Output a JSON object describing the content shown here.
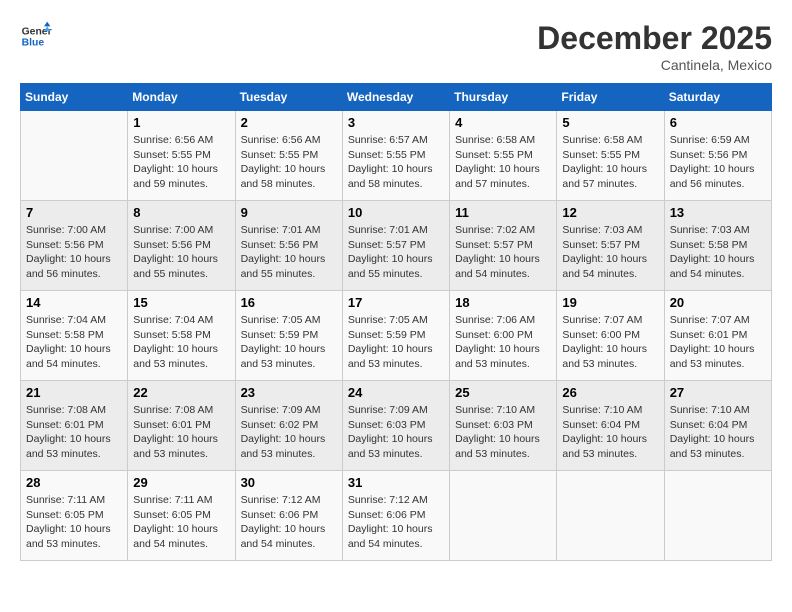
{
  "logo": {
    "text_general": "General",
    "text_blue": "Blue"
  },
  "title": "December 2025",
  "subtitle": "Cantinela, Mexico",
  "header_days": [
    "Sunday",
    "Monday",
    "Tuesday",
    "Wednesday",
    "Thursday",
    "Friday",
    "Saturday"
  ],
  "weeks": [
    [
      {
        "day": "",
        "info": ""
      },
      {
        "day": "1",
        "info": "Sunrise: 6:56 AM\nSunset: 5:55 PM\nDaylight: 10 hours\nand 59 minutes."
      },
      {
        "day": "2",
        "info": "Sunrise: 6:56 AM\nSunset: 5:55 PM\nDaylight: 10 hours\nand 58 minutes."
      },
      {
        "day": "3",
        "info": "Sunrise: 6:57 AM\nSunset: 5:55 PM\nDaylight: 10 hours\nand 58 minutes."
      },
      {
        "day": "4",
        "info": "Sunrise: 6:58 AM\nSunset: 5:55 PM\nDaylight: 10 hours\nand 57 minutes."
      },
      {
        "day": "5",
        "info": "Sunrise: 6:58 AM\nSunset: 5:55 PM\nDaylight: 10 hours\nand 57 minutes."
      },
      {
        "day": "6",
        "info": "Sunrise: 6:59 AM\nSunset: 5:56 PM\nDaylight: 10 hours\nand 56 minutes."
      }
    ],
    [
      {
        "day": "7",
        "info": "Sunrise: 7:00 AM\nSunset: 5:56 PM\nDaylight: 10 hours\nand 56 minutes."
      },
      {
        "day": "8",
        "info": "Sunrise: 7:00 AM\nSunset: 5:56 PM\nDaylight: 10 hours\nand 55 minutes."
      },
      {
        "day": "9",
        "info": "Sunrise: 7:01 AM\nSunset: 5:56 PM\nDaylight: 10 hours\nand 55 minutes."
      },
      {
        "day": "10",
        "info": "Sunrise: 7:01 AM\nSunset: 5:57 PM\nDaylight: 10 hours\nand 55 minutes."
      },
      {
        "day": "11",
        "info": "Sunrise: 7:02 AM\nSunset: 5:57 PM\nDaylight: 10 hours\nand 54 minutes."
      },
      {
        "day": "12",
        "info": "Sunrise: 7:03 AM\nSunset: 5:57 PM\nDaylight: 10 hours\nand 54 minutes."
      },
      {
        "day": "13",
        "info": "Sunrise: 7:03 AM\nSunset: 5:58 PM\nDaylight: 10 hours\nand 54 minutes."
      }
    ],
    [
      {
        "day": "14",
        "info": "Sunrise: 7:04 AM\nSunset: 5:58 PM\nDaylight: 10 hours\nand 54 minutes."
      },
      {
        "day": "15",
        "info": "Sunrise: 7:04 AM\nSunset: 5:58 PM\nDaylight: 10 hours\nand 53 minutes."
      },
      {
        "day": "16",
        "info": "Sunrise: 7:05 AM\nSunset: 5:59 PM\nDaylight: 10 hours\nand 53 minutes."
      },
      {
        "day": "17",
        "info": "Sunrise: 7:05 AM\nSunset: 5:59 PM\nDaylight: 10 hours\nand 53 minutes."
      },
      {
        "day": "18",
        "info": "Sunrise: 7:06 AM\nSunset: 6:00 PM\nDaylight: 10 hours\nand 53 minutes."
      },
      {
        "day": "19",
        "info": "Sunrise: 7:07 AM\nSunset: 6:00 PM\nDaylight: 10 hours\nand 53 minutes."
      },
      {
        "day": "20",
        "info": "Sunrise: 7:07 AM\nSunset: 6:01 PM\nDaylight: 10 hours\nand 53 minutes."
      }
    ],
    [
      {
        "day": "21",
        "info": "Sunrise: 7:08 AM\nSunset: 6:01 PM\nDaylight: 10 hours\nand 53 minutes."
      },
      {
        "day": "22",
        "info": "Sunrise: 7:08 AM\nSunset: 6:01 PM\nDaylight: 10 hours\nand 53 minutes."
      },
      {
        "day": "23",
        "info": "Sunrise: 7:09 AM\nSunset: 6:02 PM\nDaylight: 10 hours\nand 53 minutes."
      },
      {
        "day": "24",
        "info": "Sunrise: 7:09 AM\nSunset: 6:03 PM\nDaylight: 10 hours\nand 53 minutes."
      },
      {
        "day": "25",
        "info": "Sunrise: 7:10 AM\nSunset: 6:03 PM\nDaylight: 10 hours\nand 53 minutes."
      },
      {
        "day": "26",
        "info": "Sunrise: 7:10 AM\nSunset: 6:04 PM\nDaylight: 10 hours\nand 53 minutes."
      },
      {
        "day": "27",
        "info": "Sunrise: 7:10 AM\nSunset: 6:04 PM\nDaylight: 10 hours\nand 53 minutes."
      }
    ],
    [
      {
        "day": "28",
        "info": "Sunrise: 7:11 AM\nSunset: 6:05 PM\nDaylight: 10 hours\nand 53 minutes."
      },
      {
        "day": "29",
        "info": "Sunrise: 7:11 AM\nSunset: 6:05 PM\nDaylight: 10 hours\nand 54 minutes."
      },
      {
        "day": "30",
        "info": "Sunrise: 7:12 AM\nSunset: 6:06 PM\nDaylight: 10 hours\nand 54 minutes."
      },
      {
        "day": "31",
        "info": "Sunrise: 7:12 AM\nSunset: 6:06 PM\nDaylight: 10 hours\nand 54 minutes."
      },
      {
        "day": "",
        "info": ""
      },
      {
        "day": "",
        "info": ""
      },
      {
        "day": "",
        "info": ""
      }
    ]
  ]
}
